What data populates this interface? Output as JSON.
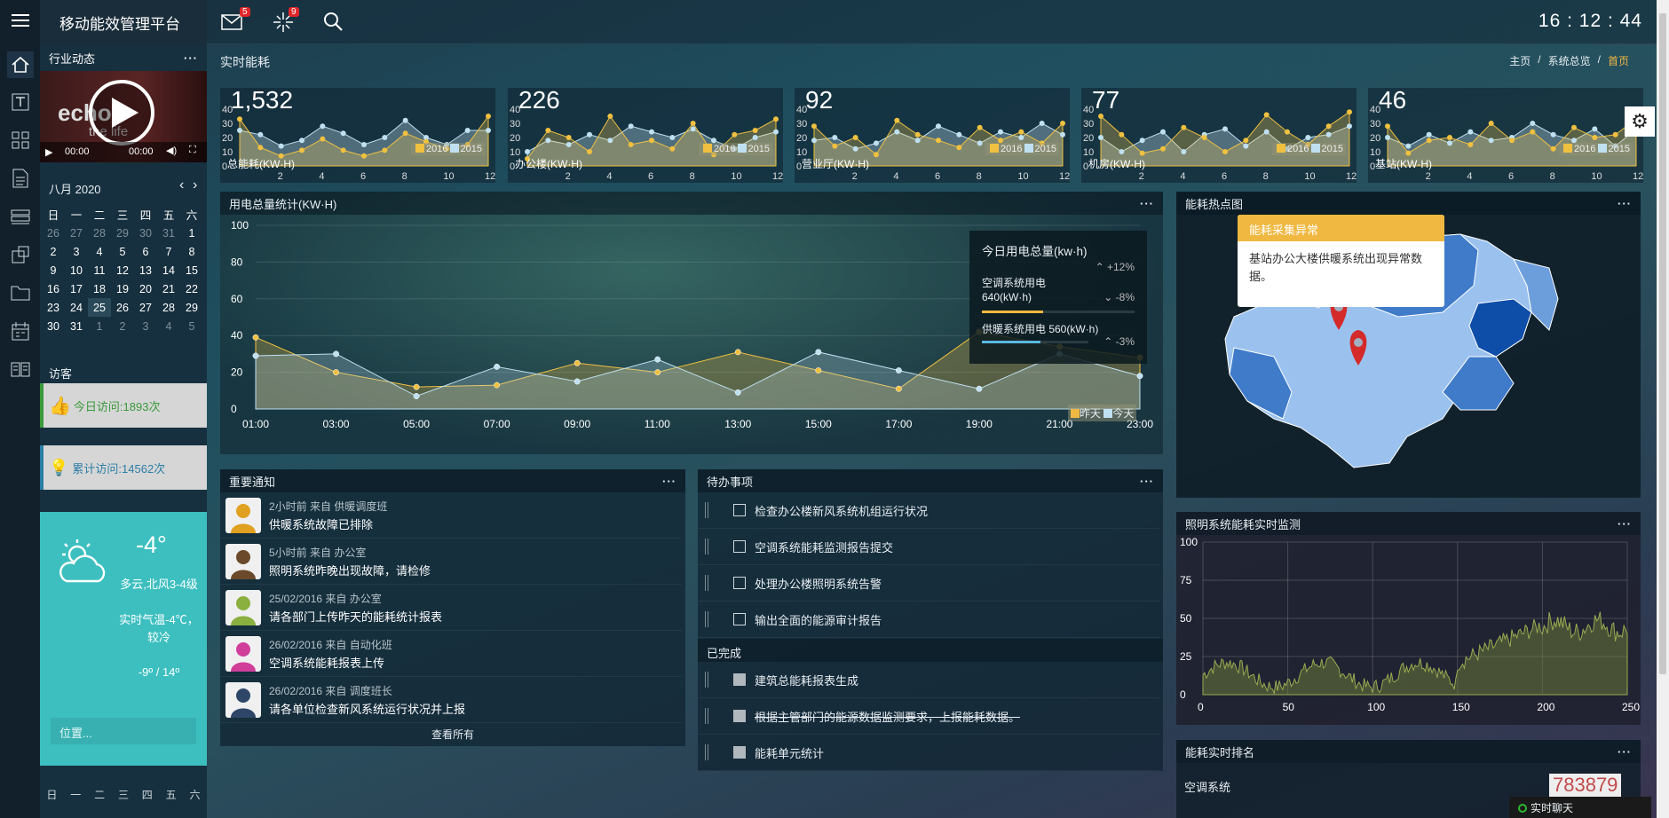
{
  "app": {
    "title": "移动能效管理平台"
  },
  "topbar": {
    "mail_count": "5",
    "tasks_count": "9",
    "clock": "16 : 12 : 44"
  },
  "subbar": {
    "title": "实时能耗",
    "breadcrumb": [
      "主页",
      "系统总览",
      "首页"
    ],
    "sep": "/"
  },
  "left": {
    "industry_title": "行业动态",
    "video": {
      "brand": "echo",
      "brand2": "the life",
      "time1": "00:00",
      "time2": "00:00"
    },
    "calendar": {
      "month": "八月 2020",
      "weekdays": [
        "日",
        "一",
        "二",
        "三",
        "四",
        "五",
        "六"
      ],
      "rows": [
        [
          "26",
          "27",
          "28",
          "29",
          "30",
          "31",
          "1"
        ],
        [
          "2",
          "3",
          "4",
          "5",
          "6",
          "7",
          "8"
        ],
        [
          "9",
          "10",
          "11",
          "12",
          "13",
          "14",
          "15"
        ],
        [
          "16",
          "17",
          "18",
          "19",
          "20",
          "21",
          "22"
        ],
        [
          "23",
          "24",
          "25",
          "26",
          "27",
          "28",
          "29"
        ],
        [
          "30",
          "31",
          "1",
          "2",
          "3",
          "4",
          "5"
        ]
      ]
    },
    "visitors_title": "访客",
    "today_visits": "今日访问:1893次",
    "total_visits": "累计访问:14562次",
    "weather": {
      "temp": "-4°",
      "desc": "多云,北风3-4级",
      "desc2": "实时气温-4℃，较冷",
      "range": "-9º / 14º",
      "location_placeholder": "位置..."
    },
    "week_footer": [
      "日",
      "一",
      "二",
      "三",
      "四",
      "五",
      "六"
    ]
  },
  "mini_charts": [
    {
      "value": "1,532",
      "label": "总能耗(KW·H)"
    },
    {
      "value": "226",
      "label": "办公楼(KW·H)"
    },
    {
      "value": "92",
      "label": "营业厅(KW·H)"
    },
    {
      "value": "77",
      "label": "机房(KW·H)"
    },
    {
      "value": "46",
      "label": "基站(KW·H)"
    }
  ],
  "mini_axis": {
    "y": [
      "40",
      "30",
      "20",
      "10",
      "0"
    ],
    "x": [
      "2",
      "4",
      "6",
      "8",
      "10",
      "12"
    ],
    "legend": [
      "2016",
      "2015"
    ]
  },
  "power_chart": {
    "title": "用电总量统计(KW·H)",
    "legend": [
      "昨天",
      "今天"
    ],
    "y_ticks": [
      "100",
      "80",
      "60",
      "40",
      "20",
      "0"
    ],
    "x_ticks": [
      "01:00",
      "03:00",
      "05:00",
      "07:00",
      "09:00",
      "11:00",
      "13:00",
      "15:00",
      "17:00",
      "19:00",
      "21:00",
      "23:00"
    ]
  },
  "chart_data": [
    {
      "type": "area",
      "title": "用电总量统计(KW·H)",
      "ylim": [
        0,
        100
      ],
      "categories": [
        "01:00",
        "03:00",
        "05:00",
        "07:00",
        "09:00",
        "11:00",
        "13:00",
        "15:00",
        "17:00",
        "19:00",
        "21:00",
        "23:00"
      ],
      "series": [
        {
          "name": "昨天",
          "values": [
            39,
            20,
            12,
            13,
            25,
            20,
            31,
            21,
            11,
            42,
            34,
            28
          ]
        },
        {
          "name": "今天",
          "values": [
            29,
            30,
            7,
            23,
            15,
            27,
            9,
            31,
            21,
            11,
            30,
            18
          ]
        }
      ]
    },
    {
      "type": "area",
      "title": "照明系统能耗实时监测",
      "xlim": [
        0,
        250
      ],
      "ylim": [
        0,
        100
      ],
      "x_ticks": [
        0,
        50,
        100,
        150,
        200,
        250
      ],
      "y_ticks": [
        0,
        25,
        50,
        75,
        100
      ]
    }
  ],
  "today_panel": {
    "title": "今日用电总量(kw·h)",
    "total_change": "+12%",
    "ac_label": "空调系统用电",
    "ac_value": "640(kW·h)",
    "ac_change": "-8%",
    "heat_label": "供暖系统用电 560(kW·h)",
    "heat_change": "-3%"
  },
  "heatmap": {
    "title": "能耗热点图",
    "popup_title": "能耗采集异常",
    "popup_body": "基站办公大楼供暖系统出现异常数据。"
  },
  "lighting": {
    "title": "照明系统能耗实时监测"
  },
  "ranking": {
    "title": "能耗实时排名",
    "row1": "空调系统",
    "row1_value": "783879"
  },
  "notices": {
    "title": "重要通知",
    "items": [
      {
        "meta": "2小时前 来自 供暖调度班",
        "text": "供暖系统故障已排除",
        "color": "#e0a020"
      },
      {
        "meta": "5小时前 来自 办公室",
        "text": "照明系统昨晚出现故障，请检修",
        "color": "#6a4a2a"
      },
      {
        "meta": "25/02/2016 来自 办公室",
        "text": "请各部门上传昨天的能耗统计报表",
        "color": "#8ab040"
      },
      {
        "meta": "26/02/2016 来自 自动化班",
        "text": "空调系统能耗报表上传",
        "color": "#d03e9a"
      },
      {
        "meta": "26/02/2016 来自 调度班长",
        "text": "请各单位检查新风系统运行状况并上报",
        "color": "#2e4668"
      }
    ],
    "view_all": "查看所有"
  },
  "todos": {
    "title": "待办事项",
    "pending": [
      "检查办公楼新风系统机组运行状况",
      "空调系统能耗监测报告提交",
      "处理办公楼照明系统告警",
      "输出全面的能源审计报告"
    ],
    "done_title": "已完成",
    "done": [
      "建筑总能耗报表生成",
      "根据主管部门的能源数据监测要求，上报能耗数据。",
      "能耗单元统计"
    ]
  },
  "chat": {
    "label": "实时聊天"
  },
  "colors": {
    "accent": "#f0b840",
    "teal": "#3dbfc0",
    "bg": "#1f4a5a"
  }
}
